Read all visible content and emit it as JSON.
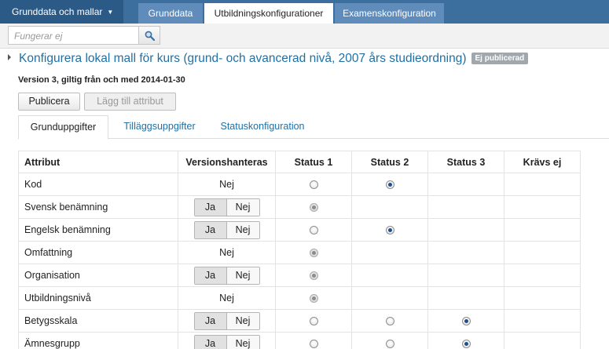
{
  "topnav": {
    "menu_label": "Grunddata och mallar",
    "tabs": [
      {
        "label": "Grunddata",
        "active": false
      },
      {
        "label": "Utbildningskonfigurationer",
        "active": true
      },
      {
        "label": "Examenskonfiguration",
        "active": false
      }
    ]
  },
  "search": {
    "placeholder": "Fungerar ej",
    "icon": "search-icon"
  },
  "page": {
    "title": "Konfigurera lokal mall för kurs (grund- och avancerad nivå, 2007 års studieordning)",
    "status_badge": "Ej publicerad",
    "version_text": "Version 3, giltig från och med 2014-01-30"
  },
  "actions": {
    "publish": "Publicera",
    "add_attribute": "Lägg till attribut"
  },
  "subtabs": [
    {
      "label": "Grunduppgifter",
      "active": true
    },
    {
      "label": "Tilläggsuppgifter",
      "active": false
    },
    {
      "label": "Statuskonfiguration",
      "active": false
    }
  ],
  "table": {
    "headers": [
      "Attribut",
      "Versionshanteras",
      "Status 1",
      "Status 2",
      "Status 3",
      "Krävs ej"
    ],
    "toggle": {
      "yes": "Ja",
      "no": "Nej"
    },
    "rows": [
      {
        "attribute": "Kod",
        "versioned": "Nej",
        "statuses": [
          "empty",
          "checked",
          "none",
          "none"
        ]
      },
      {
        "attribute": "Svensk benämning",
        "versioned": "toggle",
        "statuses": [
          "disabled",
          "none",
          "none",
          "none"
        ]
      },
      {
        "attribute": "Engelsk benämning",
        "versioned": "toggle",
        "statuses": [
          "empty",
          "checked",
          "none",
          "none"
        ]
      },
      {
        "attribute": "Omfattning",
        "versioned": "Nej",
        "statuses": [
          "disabled",
          "none",
          "none",
          "none"
        ]
      },
      {
        "attribute": "Organisation",
        "versioned": "toggle",
        "statuses": [
          "disabled",
          "none",
          "none",
          "none"
        ]
      },
      {
        "attribute": "Utbildningsnivå",
        "versioned": "Nej",
        "statuses": [
          "disabled",
          "none",
          "none",
          "none"
        ]
      },
      {
        "attribute": "Betygsskala",
        "versioned": "toggle",
        "statuses": [
          "empty",
          "empty",
          "checked",
          "none"
        ]
      },
      {
        "attribute": "Ämnesgrupp",
        "versioned": "toggle",
        "statuses": [
          "empty",
          "empty",
          "checked",
          "none"
        ]
      }
    ]
  }
}
